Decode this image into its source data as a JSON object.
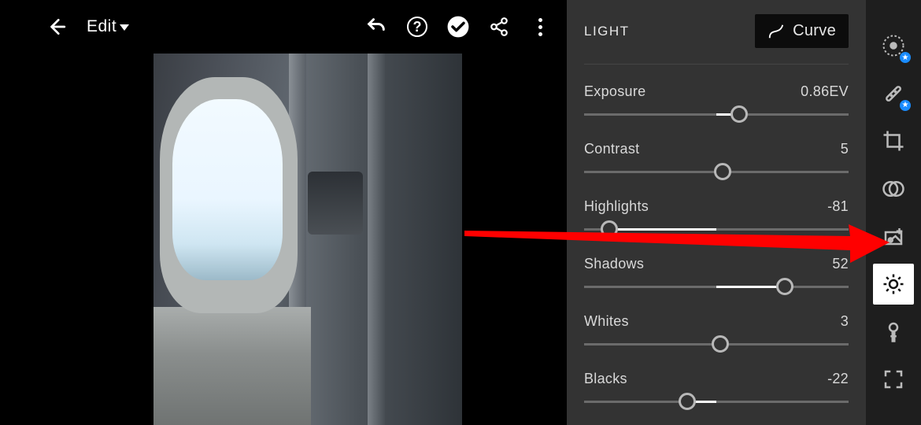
{
  "topbar": {
    "title": "Edit",
    "icons": {
      "back": "back-arrow-icon",
      "undo": "undo-icon",
      "help": "help-icon",
      "confirm": "before-after-icon",
      "share": "share-icon",
      "menu": "kebab-menu-icon"
    }
  },
  "panel": {
    "title": "LIGHT",
    "curve_label": "Curve",
    "sliders": [
      {
        "label": "Exposure",
        "value_text": "0.86EV",
        "min": -5,
        "max": 5,
        "value": 0.86,
        "center": 0
      },
      {
        "label": "Contrast",
        "value_text": "5",
        "min": -100,
        "max": 100,
        "value": 5,
        "center": 0
      },
      {
        "label": "Highlights",
        "value_text": "-81",
        "min": -100,
        "max": 100,
        "value": -81,
        "center": 0
      },
      {
        "label": "Shadows",
        "value_text": "52",
        "min": -100,
        "max": 100,
        "value": 52,
        "center": 0
      },
      {
        "label": "Whites",
        "value_text": "3",
        "min": -100,
        "max": 100,
        "value": 3,
        "center": 0
      },
      {
        "label": "Blacks",
        "value_text": "-22",
        "min": -100,
        "max": 100,
        "value": -22,
        "center": 0
      }
    ]
  },
  "toolrail": [
    {
      "name": "lens-profile-icon",
      "active": false,
      "badge": true,
      "id": "lens"
    },
    {
      "name": "healing-icon",
      "active": false,
      "badge": true,
      "id": "healing"
    },
    {
      "name": "crop-icon",
      "active": false,
      "badge": false,
      "id": "crop"
    },
    {
      "name": "masking-icon",
      "active": false,
      "badge": false,
      "id": "masking"
    },
    {
      "name": "versions-icon",
      "active": false,
      "badge": false,
      "id": "versions"
    },
    {
      "name": "light-icon",
      "active": true,
      "badge": false,
      "id": "light"
    },
    {
      "name": "color-temp-icon",
      "active": false,
      "badge": false,
      "id": "color"
    },
    {
      "name": "fullscreen-icon",
      "active": false,
      "badge": false,
      "id": "frame"
    }
  ],
  "colors": {
    "panel_bg": "#333333",
    "rail_bg": "#1e1e1e",
    "track": "#6b6b6b",
    "thumb": "#b8b8b8",
    "accent": "#1a8cff",
    "arrow": "#ff0000"
  }
}
